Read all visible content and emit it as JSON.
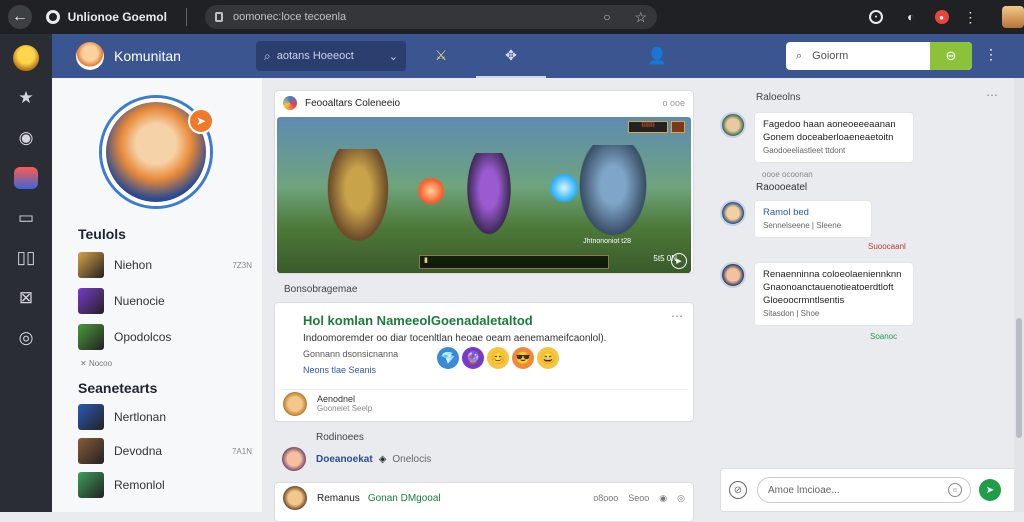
{
  "browser": {
    "tab_title": "Unlionoe Goemol",
    "url": "oomonec:loce tecoenla"
  },
  "header": {
    "app_title": "Komunitan",
    "search_text": "aotans  Hoeeoct",
    "input_placeholder": "Goiorm"
  },
  "profile": {
    "friends_title": "Teulols",
    "friends": [
      {
        "name": "Niehon",
        "meta": "7Z3N",
        "color": "#d8a24a"
      },
      {
        "name": "Nuenocie",
        "meta": "",
        "color": "#7a3ac8"
      },
      {
        "name": "Opodolcos",
        "meta": "",
        "color": "#4a9a3a"
      }
    ],
    "more_friends": "Nocoo",
    "searches_title": "Seanetearts",
    "searches": [
      {
        "name": "Nertlonan",
        "meta": "",
        "color": "#2a5ab5"
      },
      {
        "name": "Devodna",
        "meta": "7A1N",
        "color": "#8a5a3a"
      },
      {
        "name": "Remonlol",
        "meta": "",
        "color": "#3aa05a"
      }
    ]
  },
  "feed": {
    "post1_title": "Feooaltars Coleneeio",
    "post1_meta": "o ooe",
    "game": {
      "score": "5t5 0N",
      "name_tag": "Jhtnononiot t28",
      "hud_bar": "IIIIIII"
    },
    "label1": "Bonsobragemae",
    "post2": {
      "title": "Hol komlan NameeolGoenadaletaltod",
      "body": "Indoomoremder oo diar tocenltlan heoae oeam aenemameifcaonlol).",
      "sub": "Gonnann  dsonsicnanna",
      "link": "Neons tlae Seanis",
      "emojis": [
        "💎",
        "🔮",
        "😊",
        "😎",
        "😄"
      ],
      "author": "Aenodnel",
      "author_sub": "Gooneiet Seelp"
    },
    "label2": "Rodinoees",
    "row": {
      "name": "Doeanoekat",
      "text": "Onelocis"
    },
    "post3": {
      "name": "Remanus",
      "group": "Gonan DMgooal",
      "count": "o8ooo",
      "likes": "Seoo"
    }
  },
  "right": {
    "title": "Raloeolns",
    "messages": [
      {
        "text": "Fagedoo haan aoneoeeeaanan Gonem doceaberloaeneaetoitn",
        "sub": "Gaodoeeliastleet ttdont",
        "time": "oooe  ocoonan"
      },
      {
        "text": "Ramol bed",
        "sub": "Sennelseene | Sleene",
        "time": "Suoocaanl"
      },
      {
        "text": "Renaenninna coloeolaeniennknn Gnaonoanctauenotieatoerdtloft Gloeoocrmntlsentis",
        "sub": "Sitasdon | Shoe",
        "time": "Soanoc"
      }
    ],
    "subtitle": "Raoooeatel",
    "input_placeholder": "Amoe lmcioae..."
  }
}
